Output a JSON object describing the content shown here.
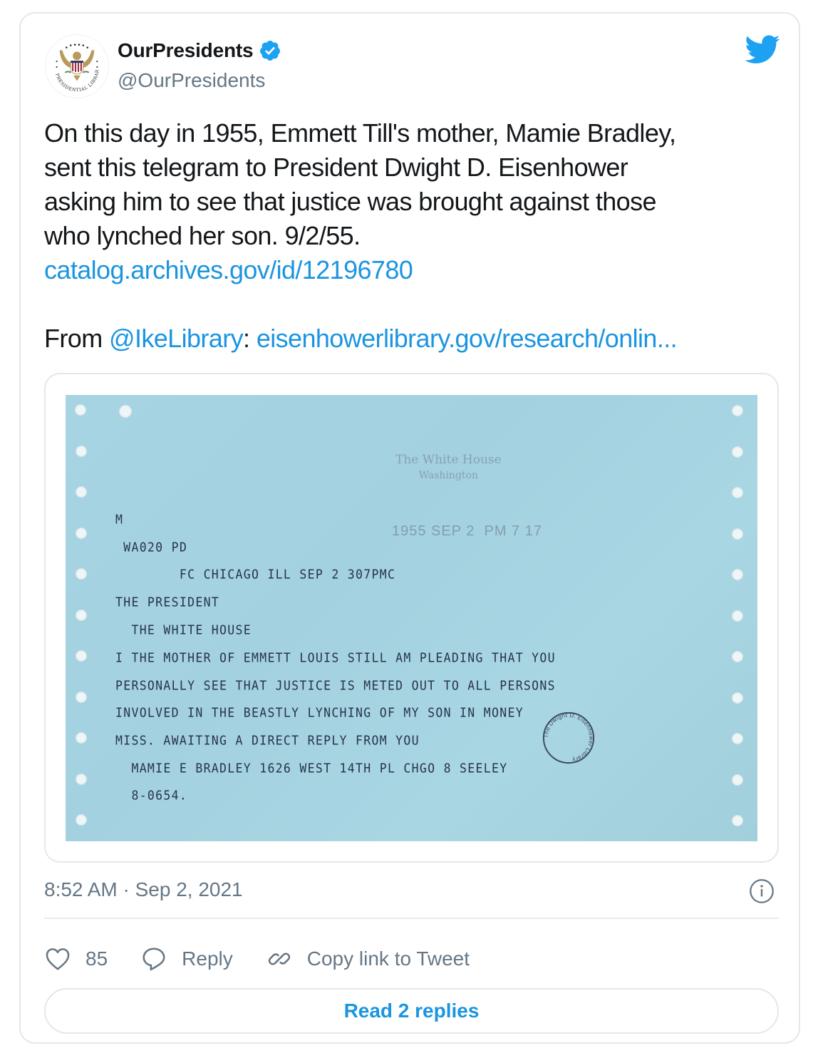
{
  "author": {
    "display_name": "OurPresidents",
    "handle": "@OurPresidents",
    "verified": true,
    "avatar_icon": "presidential-libraries-eagle-seal",
    "avatar_text": "PRESIDENTIAL LIBRARIES"
  },
  "brand_icon": "twitter-bird-icon",
  "colors": {
    "link": "#1b95e0",
    "twitter_blue": "#1da1f2",
    "text_primary": "#14171a",
    "text_secondary": "#657786",
    "border": "#e1e8ed",
    "telegram_paper": "#a7d4e2"
  },
  "tweet": {
    "lines": [
      "On this day in 1955, Emmett Till's mother, Mamie Bradley,",
      "sent this telegram to President Dwight D. Eisenhower",
      "asking him to see that justice was brought against those",
      "who lynched her son. 9/2/55."
    ],
    "link1": "catalog.archives.gov/id/12196780",
    "from_label": "From ",
    "mention": "@IkeLibrary",
    "colon": ": ",
    "link2": "eisenhowerlibrary.gov/research/onlin..."
  },
  "telegram": {
    "stamp_header": "The White House",
    "stamp_sub": "Washington",
    "stamp_date": "1955 SEP 2  PM 7 17",
    "lines": [
      "M",
      " WA020 PD",
      "        FC CHICAGO ILL SEP 2 307PMC",
      "THE PRESIDENT",
      "  THE WHITE HOUSE",
      "I THE MOTHER OF EMMETT LOUIS STILL AM PLEADING THAT YOU",
      "PERSONALLY SEE THAT JUSTICE IS METED OUT TO ALL PERSONS",
      "INVOLVED IN THE BEASTLY LYNCHING OF MY SON IN MONEY",
      "MISS. AWAITING A DIRECT REPLY FROM YOU",
      "  MAMIE E BRADLEY 1626 WEST 14TH PL CHGO 8 SEELEY",
      "  8-0654."
    ],
    "library_stamp_text": "The Dwight D. Eisenhower Library"
  },
  "meta": {
    "timestamp": "8:52 AM · Sep 2, 2021"
  },
  "actions": {
    "like_count": "85",
    "reply_label": "Reply",
    "copy_link_label": "Copy link to Tweet",
    "read_replies_label": "Read 2 replies"
  }
}
